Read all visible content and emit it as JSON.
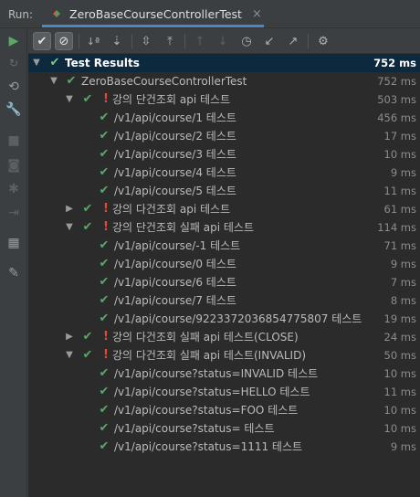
{
  "header": {
    "run_label": "Run:",
    "tab_title": "ZeroBaseCourseControllerTest",
    "tab_close": "×"
  },
  "colors": {
    "pass": "#59a869",
    "fail_mark": "#e5493a",
    "selection": "#0d293e",
    "tab_accent": "#4a88c7"
  },
  "sidebar": {
    "icons": [
      "run-icon",
      "rerun-failed-icon",
      "toggle-auto-test-icon",
      "wrench-icon",
      "stop-icon",
      "camera-icon",
      "debug-icon",
      "exit-icon",
      "layout-icon",
      "pin-icon"
    ]
  },
  "toolbar": {
    "icons": [
      "show-passed-icon",
      "show-ignored-icon",
      "sort-alpha-icon",
      "sort-duration-icon",
      "expand-all-icon",
      "collapse-all-icon",
      "prev-failed-icon",
      "next-failed-icon",
      "history-icon",
      "import-tests-icon",
      "export-tests-icon",
      "settings-icon"
    ]
  },
  "tree": {
    "rows": [
      {
        "name": "Test Results",
        "time": "752 ms"
      },
      {
        "name": "ZeroBaseCourseControllerTest",
        "time": "752 ms"
      },
      {
        "name": "강의 단건조회 api 테스트",
        "time": "503 ms"
      },
      {
        "name": "/v1/api/course/1 테스트",
        "time": "456 ms"
      },
      {
        "name": "/v1/api/course/2 테스트",
        "time": "17 ms"
      },
      {
        "name": "/v1/api/course/3 테스트",
        "time": "10 ms"
      },
      {
        "name": "/v1/api/course/4 테스트",
        "time": "9 ms"
      },
      {
        "name": "/v1/api/course/5 테스트",
        "time": "11 ms"
      },
      {
        "name": "강의 다건조회 api 테스트",
        "time": "61 ms"
      },
      {
        "name": "강의 단건조회 실패 api 테스트",
        "time": "114 ms"
      },
      {
        "name": "/v1/api/course/-1 테스트",
        "time": "71 ms"
      },
      {
        "name": "/v1/api/course/0 테스트",
        "time": "9 ms"
      },
      {
        "name": "/v1/api/course/6 테스트",
        "time": "7 ms"
      },
      {
        "name": "/v1/api/course/7 테스트",
        "time": "8 ms"
      },
      {
        "name": "/v1/api/course/9223372036854775807 테스트",
        "time": "19 ms"
      },
      {
        "name": "강의 다건조회 실패 api 테스트(CLOSE)",
        "time": "24 ms"
      },
      {
        "name": "강의 다건조회 실패 api 테스트(INVALID)",
        "time": "50 ms"
      },
      {
        "name": "/v1/api/course?status=INVALID 테스트",
        "time": "10 ms"
      },
      {
        "name": "/v1/api/course?status=HELLO 테스트",
        "time": "11 ms"
      },
      {
        "name": "/v1/api/course?status=FOO 테스트",
        "time": "10 ms"
      },
      {
        "name": "/v1/api/course?status= 테스트",
        "time": "10 ms"
      },
      {
        "name": "/v1/api/course?status=1111 테스트",
        "time": "9 ms"
      }
    ]
  }
}
